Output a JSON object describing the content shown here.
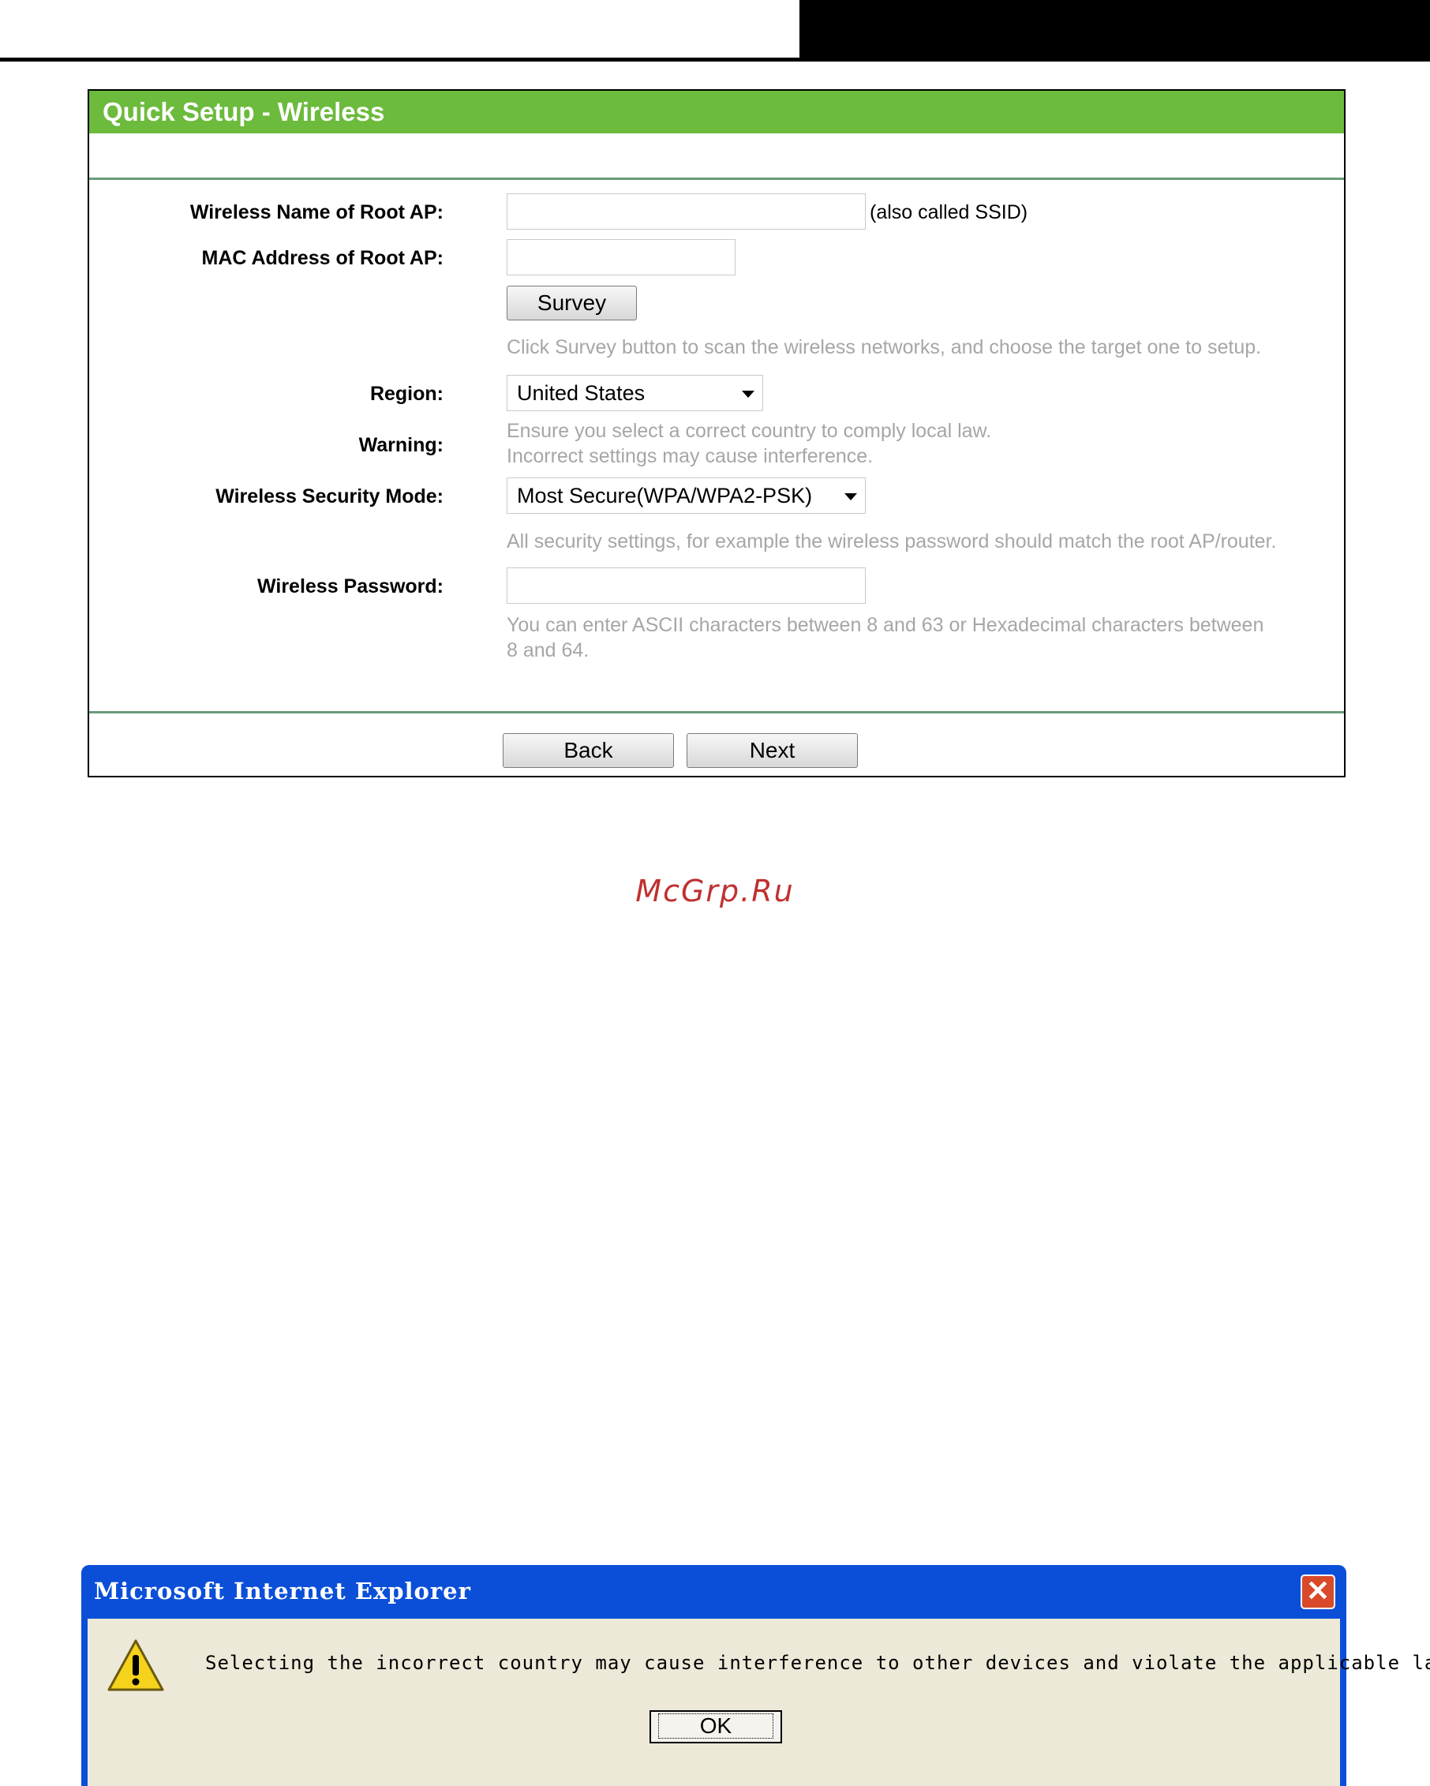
{
  "panel": {
    "title": "Quick Setup - Wireless",
    "fields": {
      "ssid_label": "Wireless Name of Root AP:",
      "ssid_value": "",
      "ssid_suffix": "(also called SSID)",
      "mac_label": "MAC Address of Root AP:",
      "mac_value": "",
      "survey_button": "Survey",
      "survey_hint": "Click Survey button to scan the wireless networks, and choose the target one to setup.",
      "region_label": "Region:",
      "region_value": "United States",
      "warning_label": "Warning:",
      "warning_line1": "Ensure you select a correct country to comply local law.",
      "warning_line2": "Incorrect settings may cause interference.",
      "security_label": "Wireless Security Mode:",
      "security_value": "Most Secure(WPA/WPA2-PSK)",
      "security_hint": "All security settings, for example the wireless password should match the root AP/router.",
      "password_label": "Wireless Password:",
      "password_value": "",
      "password_hint_line1": "You can enter ASCII characters between 8 and 63 or Hexadecimal characters between",
      "password_hint_line2": "8 and 64."
    },
    "back_button": "Back",
    "next_button": "Next"
  },
  "watermark": "McGrp.Ru",
  "dialog": {
    "title": "Microsoft Internet Explorer",
    "message": "Selecting the incorrect country may cause interference to other devices and violate the applicable law.",
    "ok_button": "OK"
  },
  "colors": {
    "header_green": "#6cbb3c",
    "hint_gray": "#a6a6a6",
    "dialog_blue": "#0b4fd8",
    "dialog_body": "#ece9d8"
  }
}
